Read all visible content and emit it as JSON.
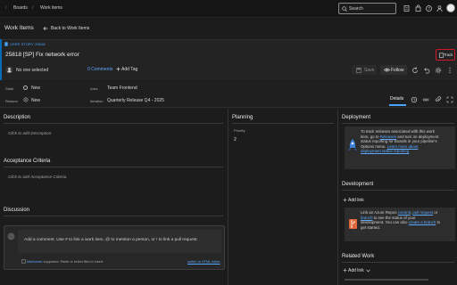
{
  "breadcrumb": {
    "first": "Boards",
    "second": "Work items"
  },
  "search": {
    "label": "Search"
  },
  "header": {
    "title": "Work Items",
    "back_label": "Back to Work Items"
  },
  "work_item": {
    "type_tag": "USER STORY 25818",
    "title": "25818   [SP] Fix network error",
    "assigned": "No one selected",
    "comments": "0 Comments",
    "add_tag": "Add Tag",
    "save": "Save",
    "follow": "Follow",
    "track": "Track"
  },
  "fields": {
    "state_label": "State",
    "state_value": "New",
    "reason_label": "Reason",
    "reason_value": "New",
    "area_label": "Area",
    "area_value": "Team Frontend",
    "iteration_label": "Iteration",
    "iteration_value": "Quarterly Release Q4 - 2025",
    "details_tab": "Details"
  },
  "left": {
    "description_title": "Description",
    "description_placeholder": "Click to add Description.",
    "acceptance_title": "Acceptance Criteria",
    "acceptance_placeholder": "Click to add Acceptance Criteria.",
    "discussion_title": "Discussion",
    "discussion_placeholder": "Add a comment. Use # to link a work item, @ to mention a person, or ! to link a pull request.",
    "markdown_link": "Markdown",
    "markdown_note": " supported. Paste or select files to insert.",
    "html_editor_link": "switch to HTML editor"
  },
  "planning": {
    "title": "Planning",
    "priority_label": "Priority",
    "priority_value": "2"
  },
  "deployment": {
    "title": "Deployment",
    "line1": "To track releases associated with this work",
    "line2_a": "item, go to ",
    "line2_link": "Releases",
    "line2_b": " and turn on deployment",
    "line3": "status reporting for Boards in your pipeline's",
    "line4_a": "Options menu. ",
    "line4_link": "Learn more about",
    "line5_link": "deployment status reporting"
  },
  "development": {
    "title": "Development",
    "add_link": "Add link",
    "line1_a": "Link an Azure Repos ",
    "line1_link1": "commit",
    "line1_b": ", ",
    "line1_link2": "pull request",
    "line1_c": " or",
    "line2_link": "branch",
    "line2_b": " to see the status of your",
    "line3_a": "development. You can also ",
    "line3_link": "create a branch",
    "line3_b": " to",
    "line4": "get started."
  },
  "related": {
    "title": "Related Work",
    "add_link": "Add link"
  },
  "colors": {
    "accent_blue": "#4aa3ff",
    "track_border": "#d0172b",
    "story_bar": "#0a6bb5"
  }
}
